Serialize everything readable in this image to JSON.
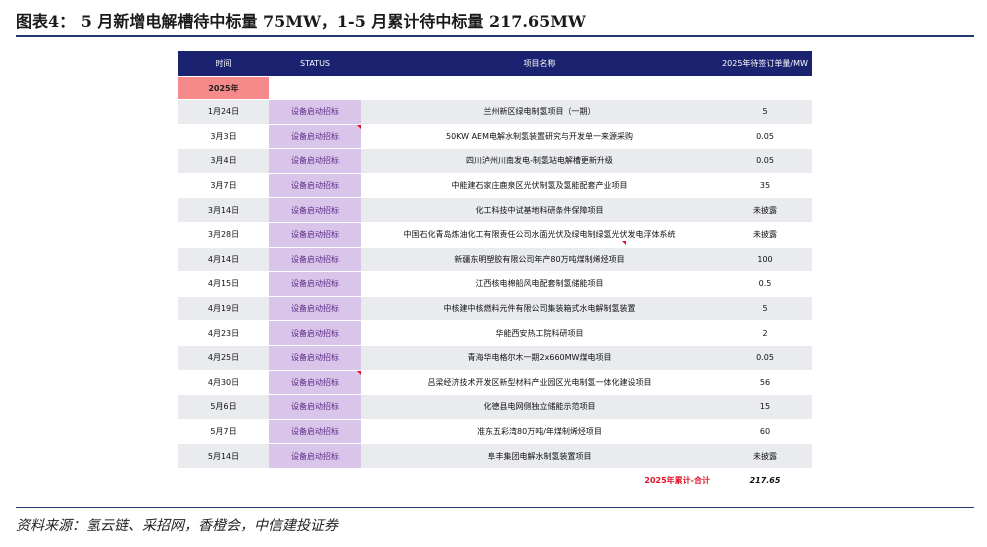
{
  "figure": {
    "title": "图表4： 5 月新增电解槽待中标量 75MW，1-5 月累计待中标量 217.65MW",
    "source": "资料来源：氢云链、采招网，香橙会，中信建投证券"
  },
  "table": {
    "headers": {
      "time": "时间",
      "status": "STATUS",
      "project": "项目名称",
      "quantity": "2025年待签订单量/MW"
    },
    "year_label": "2025年",
    "rows": [
      {
        "date": "1月24日",
        "status": "设备启动招标",
        "project": "兰州新区绿电制氢项目（一期）",
        "qty": "5"
      },
      {
        "date": "3月3日",
        "status": "设备启动招标",
        "project": "50KW AEM电解水制氢装置研究与开发单一来源采购",
        "qty": "0.05"
      },
      {
        "date": "3月4日",
        "status": "设备启动招标",
        "project": "四川泸州川南发电-制氢站电解槽更新升级",
        "qty": "0.05"
      },
      {
        "date": "3月7日",
        "status": "设备启动招标",
        "project": "中能建石家庄鹿泉区光伏制氢及氢能配套产业项目",
        "qty": "35"
      },
      {
        "date": "3月14日",
        "status": "设备启动招标",
        "project": "化工科技中试基地科研条件保障项目",
        "qty": "未披露"
      },
      {
        "date": "3月28日",
        "status": "设备启动招标",
        "project": "中国石化青岛炼油化工有限责任公司水面光伏及绿电制绿氢光伏发电浮体系统",
        "qty": "未披露"
      },
      {
        "date": "4月14日",
        "status": "设备启动招标",
        "project": "新疆东明塑胶有限公司年产80万吨煤制烯烃项目",
        "qty": "100"
      },
      {
        "date": "4月15日",
        "status": "设备启动招标",
        "project": "江西核电棉船风电配套制氢储能项目",
        "qty": "0.5"
      },
      {
        "date": "4月19日",
        "status": "设备启动招标",
        "project": "中核建中核燃料元件有限公司集装箱式水电解制氢装置",
        "qty": "5"
      },
      {
        "date": "4月23日",
        "status": "设备启动招标",
        "project": "华能西安热工院科研项目",
        "qty": "2"
      },
      {
        "date": "4月25日",
        "status": "设备启动招标",
        "project": "青海华电格尔木一期2x660MW煤电项目",
        "qty": "0.05"
      },
      {
        "date": "4月30日",
        "status": "设备启动招标",
        "project": "吕梁经济技术开发区新型材料产业园区光电制氢一体化建设项目",
        "qty": "56"
      },
      {
        "date": "5月6日",
        "status": "设备启动招标",
        "project": "化德县电网侧独立储能示范项目",
        "qty": "15"
      },
      {
        "date": "5月7日",
        "status": "设备启动招标",
        "project": "准东五彩湾80万吨/年煤制烯烃项目",
        "qty": "60"
      },
      {
        "date": "5月14日",
        "status": "设备启动招标",
        "project": "阜丰集团电解水制氢装置项目",
        "qty": "未披露"
      }
    ],
    "total": {
      "label": "2025年累计-合计",
      "value": "217.65"
    }
  }
}
